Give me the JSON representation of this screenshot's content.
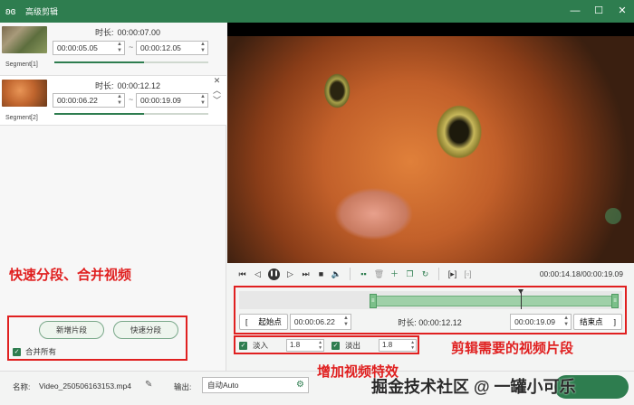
{
  "window": {
    "title": "高级剪辑",
    "minimize": "—",
    "maximize": "☐",
    "close": "✕"
  },
  "segments": [
    {
      "name": "Segment[1]",
      "duration_label": "时长:",
      "duration": "00:00:07.00",
      "start": "00:00:05.05",
      "end": "00:00:12.05",
      "separator": "~",
      "progress_fraction": 0.58
    },
    {
      "name": "Segment[2]",
      "duration_label": "时长:",
      "duration": "00:00:12.12",
      "start": "00:00:06.22",
      "end": "00:00:19.09",
      "separator": "~",
      "progress_fraction": 0.58
    }
  ],
  "left_actions": {
    "add_segment": "新增片段",
    "quick_split": "快速分段",
    "merge_all": "合并所有",
    "merge_checked": true
  },
  "annotations": {
    "left": "快速分段、合并视频",
    "trim": "剪辑需要的视频片段",
    "effects": "增加视频特效"
  },
  "player": {
    "time_readout": "00:00:14.18/00:00:19.09"
  },
  "trim": {
    "start_btn": "起始点",
    "start_bracket": "[",
    "start_value": "00:00:06.22",
    "duration_label": "时长:",
    "duration_value": "00:00:12.12",
    "end_value": "00:00:19.09",
    "end_btn": "结束点",
    "end_bracket": "]",
    "selection_start_fraction": 0.347,
    "selection_end_fraction": 1.0,
    "playhead_fraction": 0.736
  },
  "effects": {
    "fade_in_label": "淡入",
    "fade_in_value": "1.8",
    "fade_in_checked": true,
    "fade_out_label": "淡出",
    "fade_out_value": "1.8",
    "fade_out_checked": true
  },
  "bottom": {
    "name_label": "名称:",
    "name_value": "Video_250506163153.mp4",
    "output_label": "输出:",
    "output_value": "自动Auto",
    "watermark": "掘金技术社区 @ 一罐小可乐"
  },
  "colors": {
    "brand": "#2e7d4f",
    "annotation": "#e02020",
    "selection": "#9fd0a8"
  }
}
